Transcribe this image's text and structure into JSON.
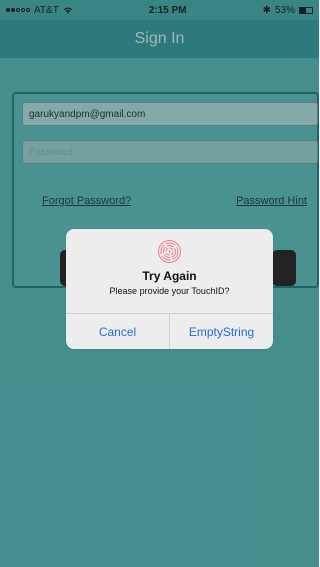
{
  "status_bar": {
    "carrier": "AT&T",
    "time": "2:15 PM",
    "battery": "53%"
  },
  "nav": {
    "title": "Sign In"
  },
  "form": {
    "email_value": "garukyandpm@gmail.com",
    "password_placeholder": "Password",
    "forgot_password": "Forgot Password?",
    "password_hint": "Password Hint"
  },
  "alert": {
    "title": "Try Again",
    "message": "Please provide your TouchID?",
    "cancel": "Cancel",
    "empty_string": "EmptyString"
  },
  "colors": {
    "accent": "#1c6fd6",
    "fingerprint": "#f07c86"
  }
}
